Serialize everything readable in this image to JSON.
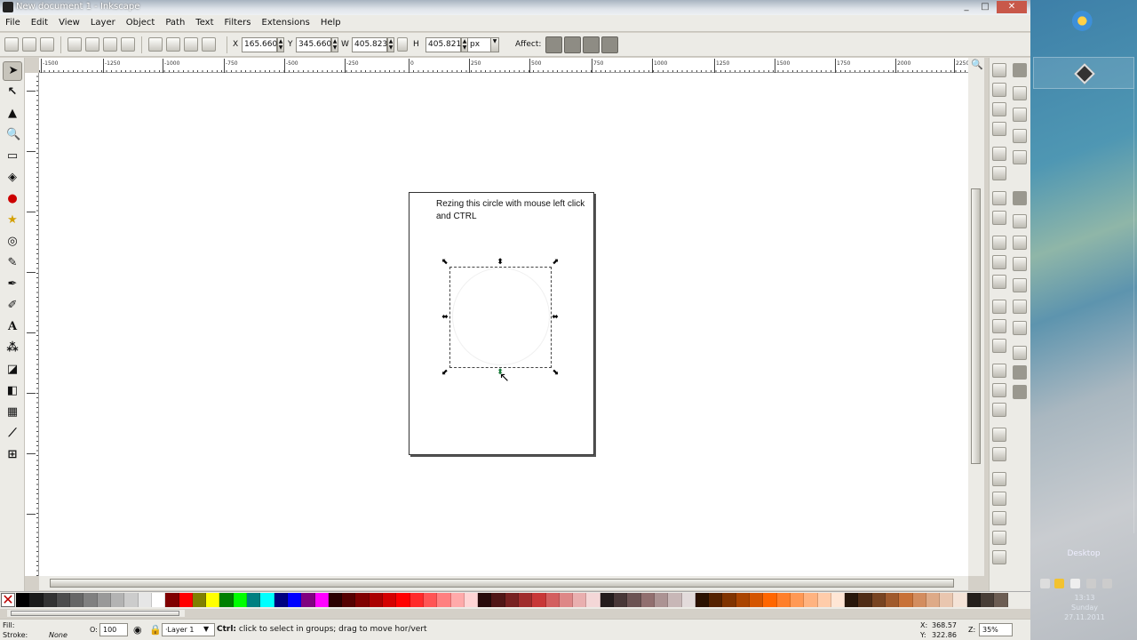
{
  "window": {
    "title": "New document 1 - Inkscape",
    "minimize": "_",
    "maximize": "□",
    "close": "✕"
  },
  "menu": [
    "File",
    "Edit",
    "View",
    "Layer",
    "Object",
    "Path",
    "Text",
    "Filters",
    "Extensions",
    "Help"
  ],
  "toolbar": {
    "x_label": "X",
    "x_value": "165.660",
    "y_label": "Y",
    "y_value": "345.660",
    "w_label": "W",
    "w_value": "405.823",
    "h_label": "H",
    "h_value": "405.821",
    "unit": "px",
    "affect_label": "Affect:"
  },
  "ruler_ticks": [
    "-1500",
    "-1250",
    "-1000",
    "-750",
    "-500",
    "-250",
    "0",
    "250",
    "500",
    "750",
    "1000",
    "1250",
    "1500",
    "1750",
    "2000",
    "2250"
  ],
  "canvas": {
    "caption": "Rezing this circle with mouse left click and CTRL"
  },
  "palette": {
    "colors": [
      "#000000",
      "#1a1a1a",
      "#333333",
      "#4d4d4d",
      "#666666",
      "#808080",
      "#999999",
      "#b3b3b3",
      "#cccccc",
      "#e6e6e6",
      "#ffffff",
      "#800000",
      "#ff0000",
      "#808000",
      "#ffff00",
      "#008000",
      "#00ff00",
      "#008080",
      "#00ffff",
      "#000080",
      "#0000ff",
      "#800080",
      "#ff00ff",
      "#2b0000",
      "#550000",
      "#800000",
      "#aa0000",
      "#d40000",
      "#ff0000",
      "#ff2a2a",
      "#ff5555",
      "#ff8080",
      "#ffaaaa",
      "#ffd5d5",
      "#280b0b",
      "#501616",
      "#782121",
      "#a02c2c",
      "#c83737",
      "#d35f5f",
      "#de8787",
      "#e9afaf",
      "#f4d7d7",
      "#241c1c",
      "#483737",
      "#6c5353",
      "#916f6f",
      "#ac9393",
      "#c8b7b7",
      "#e3dbdb",
      "#2b1100",
      "#552200",
      "#803300",
      "#aa4400",
      "#d45500",
      "#ff6600",
      "#ff7f2a",
      "#ff9955",
      "#ffb380",
      "#ffccaa",
      "#ffe6d5",
      "#28170b",
      "#502d16",
      "#784421",
      "#a05a2c",
      "#c87137",
      "#d38d5f",
      "#deaa87",
      "#e9c6af",
      "#f4e3d7",
      "#241f1c",
      "#483e37",
      "#6c5d53"
    ]
  },
  "status": {
    "fill_label": "Fill:",
    "stroke_label": "Stroke:",
    "stroke_value": "None",
    "opacity_label": "O:",
    "opacity_value": "100",
    "layer": "·Layer 1",
    "msg_bold": "Ctrl:",
    "msg_rest": " click to select in groups; drag to move hor/vert",
    "x_label": "X:",
    "x_value": "368.57",
    "y_label": "Y:",
    "y_value": "322.86",
    "zoom_label": "Z:",
    "zoom_value": "35%"
  },
  "desktop": {
    "label": "Desktop",
    "clock_time": "13:13",
    "clock_day": "Sunday",
    "clock_date": "27.11.2011"
  }
}
